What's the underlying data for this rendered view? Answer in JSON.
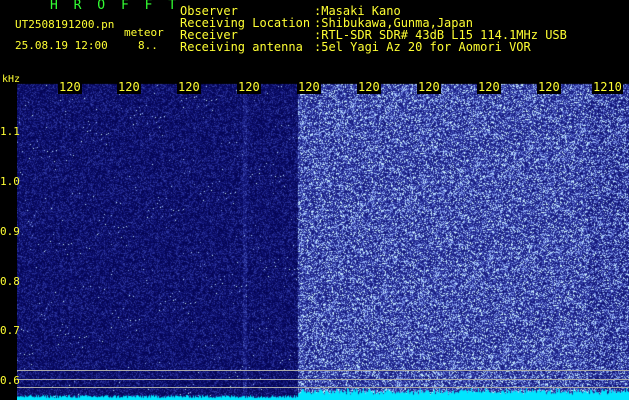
{
  "header": {
    "title": "H R O F F T",
    "filename": "UT2508191200.pn",
    "meteor_label": "meteor",
    "datetime": "25.08.19 12:00",
    "count": "8..",
    "info": [
      {
        "label": "Observer",
        "value": ":Masaki Kano"
      },
      {
        "label": "Receiving Location",
        "value": ":Shibukawa,Gunma,Japan"
      },
      {
        "label": "Receiver",
        "value": ":RTL-SDR SDR# 43dB L15 114.1MHz USB"
      },
      {
        "label": "Receiving antenna",
        "value": ":5el Yagi Az 20 for Aomori VOR"
      }
    ]
  },
  "axes": {
    "y_unit": "kHz",
    "y_ticks": [
      "1.1",
      "1.0",
      "0.9",
      "0.8",
      "0.7",
      "0.6"
    ],
    "x_ticks": [
      "120",
      "120",
      "120",
      "120",
      "120",
      "120",
      "120",
      "120",
      "120",
      "1210"
    ]
  },
  "colors": {
    "green_text": "#33ff33",
    "yellow_text": "#ffff33",
    "waterfall_low": "#0a0a3a",
    "waterfall_high": "#3a3aff",
    "spectrum_trace": "#00e5ff"
  }
}
